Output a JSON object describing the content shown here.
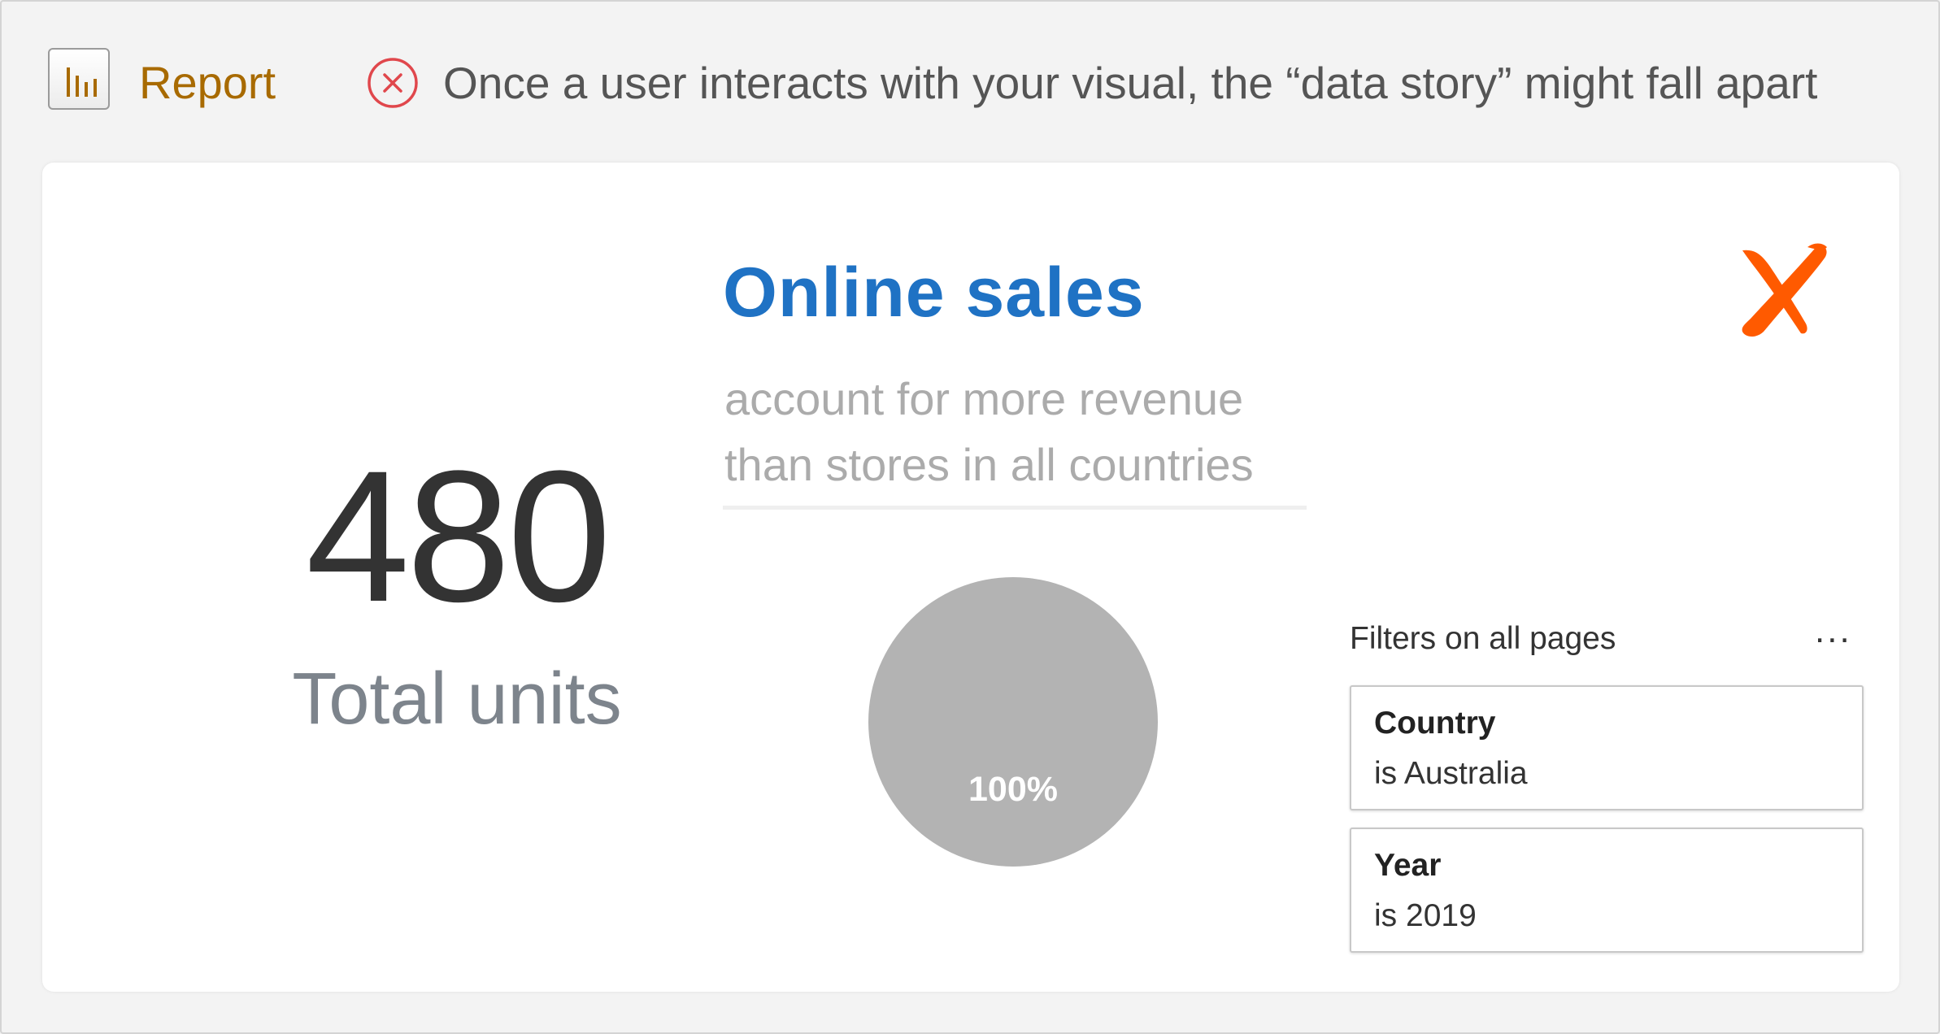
{
  "header": {
    "report_label": "Report",
    "report_icon": "bar-chart-icon",
    "warning_icon": "error-circle-x-icon",
    "warning_text": "Once a user interacts with your visual, the “data story” might fall apart"
  },
  "card": {
    "kpi": {
      "value": "480",
      "label": "Total units"
    },
    "headline": "Online sales",
    "subline": "account for more revenue\nthan stores in all countries",
    "verdict_icon": "red-x-mark-icon",
    "filters": {
      "title": "Filters on all pages",
      "more": "...",
      "items": [
        {
          "name": "Country",
          "value": "is Australia"
        },
        {
          "name": "Year",
          "value": "is 2019"
        }
      ]
    }
  },
  "chart_data": {
    "type": "pie",
    "title": "",
    "slices": [
      {
        "label": "",
        "value": 100,
        "display": "100%"
      }
    ]
  },
  "colors": {
    "brand_label": "#a86a00",
    "headline": "#1f72c4",
    "warning_red": "#e0474c",
    "x_mark": "#ff5a00",
    "pie_slice": "#b3b3b3",
    "background": "#f3f3f3"
  }
}
